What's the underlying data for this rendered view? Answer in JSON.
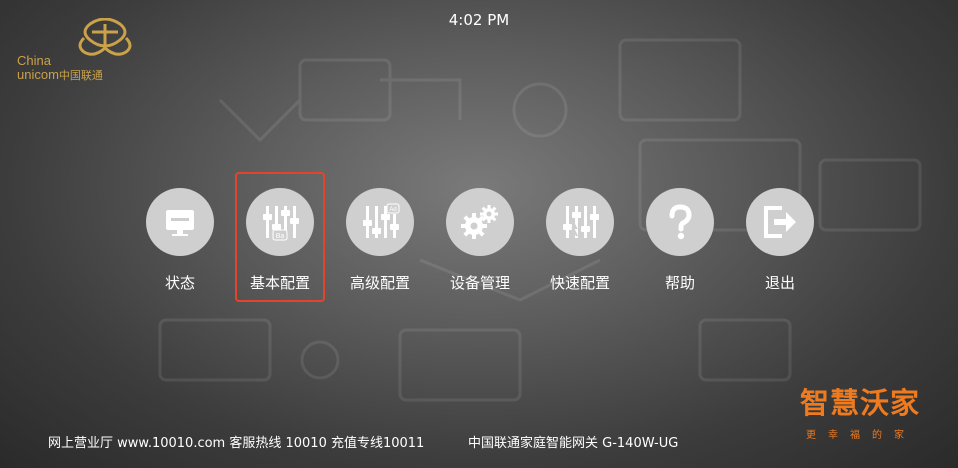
{
  "status_bar": {
    "time": "4:02 PM"
  },
  "logo": {
    "line1": "China",
    "line2": "unicom",
    "cn": "中国联通",
    "icon": "china-unicom-knot-icon"
  },
  "menu": {
    "items": [
      {
        "id": "status",
        "label": "状态",
        "icon": "monitor-icon",
        "selected": false
      },
      {
        "id": "basic-config",
        "label": "基本配置",
        "icon": "sliders-basic-icon",
        "badge": "Ba",
        "selected": true
      },
      {
        "id": "advanced-config",
        "label": "高级配置",
        "icon": "sliders-advanced-icon",
        "badge": "Ad",
        "selected": false
      },
      {
        "id": "device-management",
        "label": "设备管理",
        "icon": "gears-icon",
        "selected": false
      },
      {
        "id": "quick-config",
        "label": "快速配置",
        "icon": "sliders-quick-icon",
        "selected": false
      },
      {
        "id": "help",
        "label": "帮助",
        "icon": "question-mark-icon",
        "selected": false
      },
      {
        "id": "logout",
        "label": "退出",
        "icon": "exit-icon",
        "selected": false
      }
    ]
  },
  "footer": {
    "left": "网上营业厅 www.10010.com 客服热线 10010 充值专线10011",
    "right": "中国联通家庭智能网关 G-140W-UG"
  },
  "brand": {
    "title": "智慧沃家",
    "subtitle": "更幸福的家"
  },
  "colors": {
    "selection_border": "#e4452a",
    "brand_orange": "#f07a1e",
    "logo_gold": "#c9a24a",
    "icon_circle": "#cfcfcf"
  }
}
